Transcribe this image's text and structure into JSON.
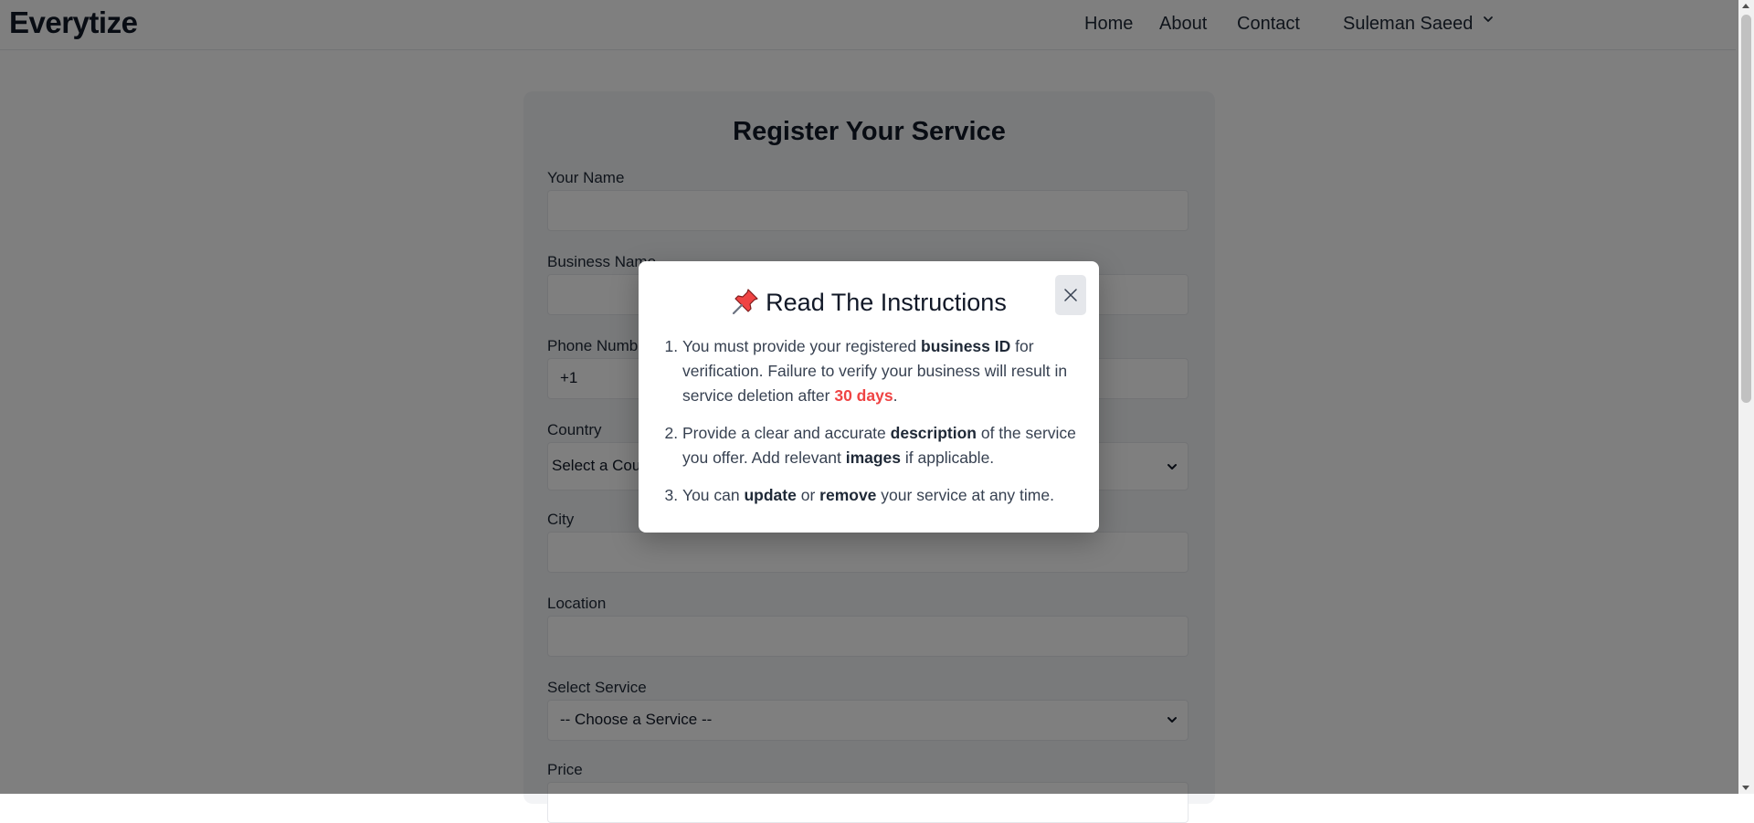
{
  "header": {
    "brand": "Everytize",
    "nav": [
      "Home",
      "About",
      "Contact"
    ],
    "user_name": "Suleman Saeed"
  },
  "form": {
    "title": "Register Your Service",
    "fields": {
      "your_name": {
        "label": "Your Name",
        "value": ""
      },
      "business_name": {
        "label": "Business Name",
        "value": ""
      },
      "phone_number": {
        "label": "Phone Number",
        "value": "+1"
      },
      "country": {
        "label": "Country",
        "value": "Select a Country"
      },
      "city": {
        "label": "City",
        "value": ""
      },
      "location": {
        "label": "Location",
        "value": ""
      },
      "service": {
        "label": "Select Service",
        "value": "-- Choose a Service --"
      },
      "price": {
        "label": "Price",
        "value": ""
      }
    }
  },
  "modal": {
    "title": "Read The Instructions",
    "icon": "pushpin-icon",
    "items": [
      {
        "t1": "You must provide your registered ",
        "b1": "business ID",
        "t2": " for verification. Failure to verify your business will result in service deletion after ",
        "r1": "30 days",
        "t3": "."
      },
      {
        "t1": "Provide a clear and accurate ",
        "b1": "description",
        "t2": " of the service you offer. Add relevant ",
        "b2": "images",
        "t3": " if applicable."
      },
      {
        "t1": "You can ",
        "b1": "update",
        "t2": " or ",
        "b2": "remove",
        "t3": " your service at any time."
      }
    ]
  },
  "colors": {
    "accent_red": "#ef4444",
    "overlay": "rgba(0,0,0,0.5)"
  }
}
